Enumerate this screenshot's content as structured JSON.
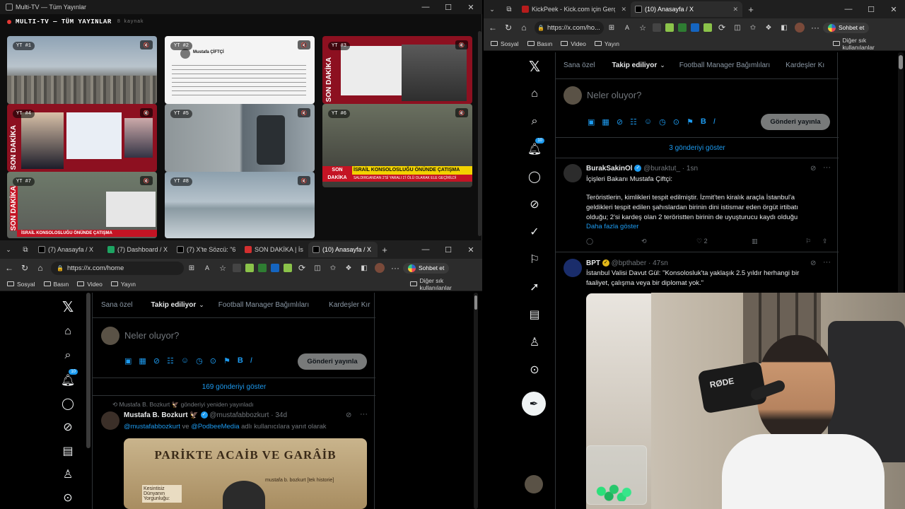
{
  "multitv": {
    "window_title": "Multi-TV — Tüm Yayınlar",
    "header_title": "MULTI-TV — TÜM YAYINLAR",
    "source_count": "8 kaynak",
    "tiles": [
      {
        "label": "YT #1"
      },
      {
        "label": "YT #2"
      },
      {
        "label": "YT #3"
      },
      {
        "label": "YT #4"
      },
      {
        "label": "YT #5"
      },
      {
        "label": "YT #6"
      },
      {
        "label": "YT #7"
      },
      {
        "label": "YT #8"
      }
    ],
    "tile_texts": {
      "son_dakika": "SON DAKİKA",
      "tile6_ticker": "İSRAİL KONSOLOSLUĞU ÖNÜNDE ÇATIŞMA",
      "tile6_subticker": "SALDIRGANDAN 2'Sİ YARALI 1'İ ÖLÜ OLARAK ELE GEÇİRİLDİ",
      "tile7_ticker": "İSRAİL KONSOLOSLUĞU ÖNÜNDE ÇATIŞMA",
      "tile2_name": "Mustafa ÇİFTÇİ"
    }
  },
  "browser_left": {
    "tabs": [
      {
        "label": "(7) Anasayfa / X"
      },
      {
        "label": "(7) Dashboard / X"
      },
      {
        "label": "(7) X'te Sözcü: \"6"
      },
      {
        "label": "SON DAKİKA | İs"
      },
      {
        "label": "(10) Anasayfa / X"
      }
    ],
    "url": "https://x.com/home",
    "copilot": "Sohbet et",
    "bookmarks": [
      "Sosyal",
      "Basın",
      "Video",
      "Yayın"
    ],
    "other_bookmarks": "Diğer sık kullanılanlar",
    "x": {
      "tabs": [
        "Sana özel",
        "Takip ediliyor",
        "Football Manager Bağımlıları",
        "Kardeşler Kır"
      ],
      "compose_placeholder": "Neler oluyor?",
      "post_button": "Gönderi yayınla",
      "show_more": "169 gönderiyi göster",
      "badge": "10",
      "tweet": {
        "reposted_by": "Mustafa B. Bozkurt 🦅 gönderiyi yeniden yayınladı",
        "name": "Mustafa B. Bozkurt 🦅",
        "handle": "@mustafabbozkurt · 34d",
        "reply_to": "@mustafabbozkurt",
        "reply_to_2": "@PodbeeMedia",
        "reply_to_and": "ve",
        "reply_to_suffix": "adlı kullanıcılara yanıt olarak",
        "poster_title": "PARİKTE ACAİB VE GARÂİB",
        "poster_sub": "mustafa b. bozkurt [tek historie]",
        "poster_side": "Kesintisiz Dünyanın Yorgunluğu:"
      }
    }
  },
  "browser_right": {
    "tabs": [
      {
        "label": "KickPeek - Kick.com için Gerçek Za"
      },
      {
        "label": "(10) Anasayfa / X"
      }
    ],
    "url": "https://x.com/ho...",
    "copilot": "Sohbet et",
    "bookmarks": [
      "Sosyal",
      "Basın",
      "Video",
      "Yayın"
    ],
    "other_bookmarks": "Diğer sık kullanılanlar",
    "x": {
      "tabs": [
        "Sana özel",
        "Takip ediliyor",
        "Football Manager Bağımlıları",
        "Kardeşler Kı"
      ],
      "compose_placeholder": "Neler oluyor?",
      "post_button": "Gönderi yayınla",
      "show_more": "3 gönderiyi göster",
      "badge": "10",
      "tweet1": {
        "name": "BurakSakinOl",
        "handle": "@buraktut_ · 1sn",
        "line1": "İçişleri Bakanı Mustafa Çiftçi:",
        "line2": "Teröristlerin, kimlikleri tespit edilmiştir. İzmit'ten kiralık araçla İstanbul'a",
        "line3": "geldikleri tespit edilen şahıslardan birinin dini istismar eden örgüt irtibatı",
        "line4": "olduğu; 2'si kardeş olan 2 teröristten birinin de uyuşturucu kaydı olduğu",
        "more": "Daha fazla göster",
        "likes": "2"
      },
      "tweet2": {
        "name": "BPT",
        "handle": "@bpthaber · 47sn",
        "line1": "İstanbul Valisi Davut Gül: \"Konsolosluk'ta yaklaşık 2.5 yıldır herhangi bir",
        "line2": "faaliyet, çalışma veya bir diplomat yok.\""
      }
    },
    "webcam": {
      "mic_brand": "RØDE"
    }
  }
}
